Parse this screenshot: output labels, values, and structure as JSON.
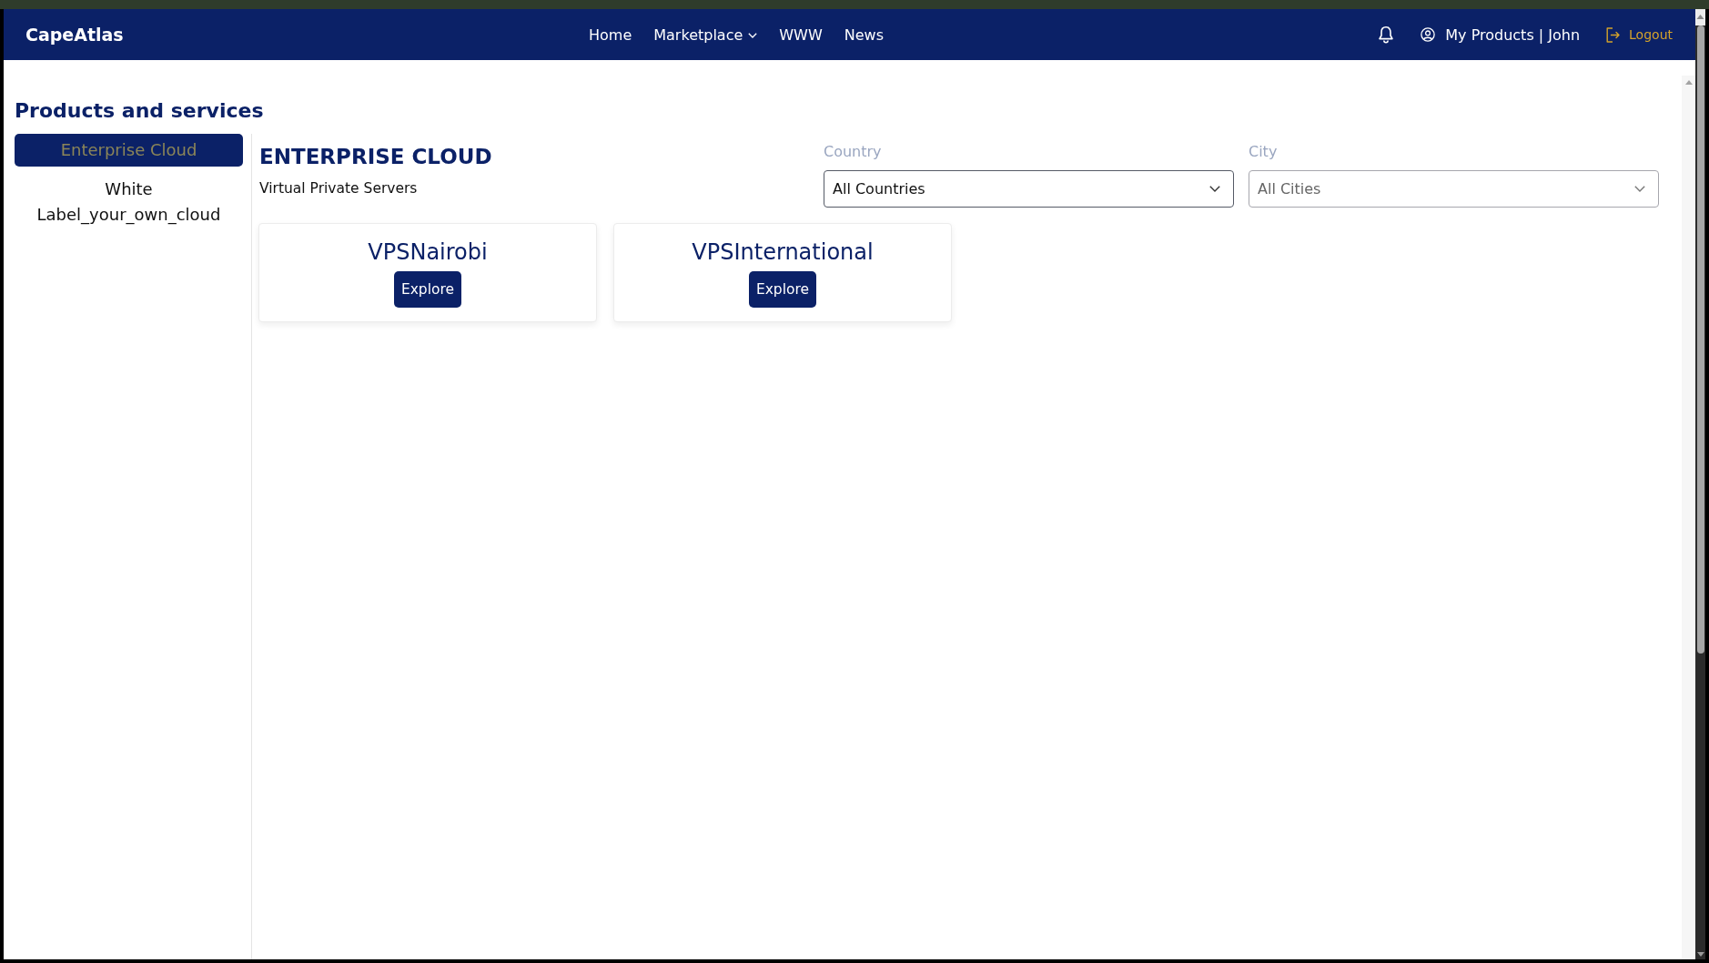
{
  "nav": {
    "logo": "CapeAtlas",
    "links": [
      {
        "label": "Home",
        "kind": "link"
      },
      {
        "label": "Marketplace",
        "kind": "dropdown"
      },
      {
        "label": "WWW",
        "kind": "link"
      },
      {
        "label": "News",
        "kind": "link"
      }
    ],
    "account": "My Products | John",
    "logout": "Logout"
  },
  "page_title": "Products and services",
  "sidebar": {
    "items": [
      {
        "label": "Enterprise Cloud",
        "selected": true
      },
      {
        "label": "White Label_your_own_cloud",
        "selected": false
      }
    ]
  },
  "section": {
    "title": "ENTERPRISE CLOUD",
    "subtitle": "Virtual Private Servers"
  },
  "filters": [
    {
      "label": "Country",
      "value": "All Countries",
      "disabled": false
    },
    {
      "label": "City",
      "value": "All Cities",
      "disabled": true
    }
  ],
  "products": [
    {
      "name": "VPSNairobi",
      "button": "Explore"
    },
    {
      "name": "VPSInternational",
      "button": "Explore"
    }
  ]
}
